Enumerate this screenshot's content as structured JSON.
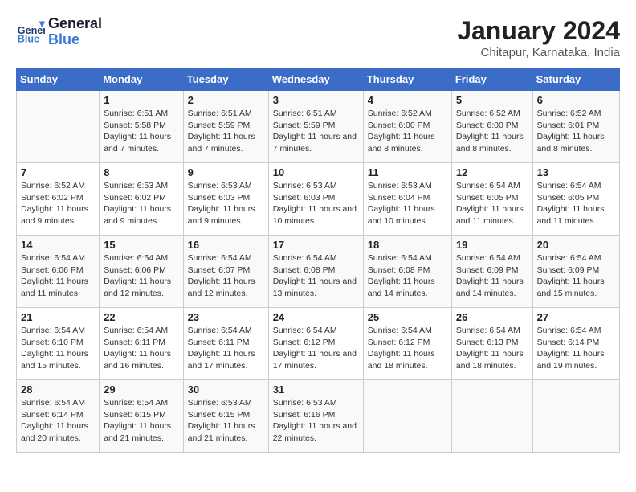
{
  "header": {
    "logo_general": "General",
    "logo_blue": "Blue",
    "title": "January 2024",
    "subtitle": "Chitapur, Karnataka, India"
  },
  "columns": [
    "Sunday",
    "Monday",
    "Tuesday",
    "Wednesday",
    "Thursday",
    "Friday",
    "Saturday"
  ],
  "weeks": [
    [
      {
        "day": "",
        "sunrise": "",
        "sunset": "",
        "daylight": ""
      },
      {
        "day": "1",
        "sunrise": "Sunrise: 6:51 AM",
        "sunset": "Sunset: 5:58 PM",
        "daylight": "Daylight: 11 hours and 7 minutes."
      },
      {
        "day": "2",
        "sunrise": "Sunrise: 6:51 AM",
        "sunset": "Sunset: 5:59 PM",
        "daylight": "Daylight: 11 hours and 7 minutes."
      },
      {
        "day": "3",
        "sunrise": "Sunrise: 6:51 AM",
        "sunset": "Sunset: 5:59 PM",
        "daylight": "Daylight: 11 hours and 7 minutes."
      },
      {
        "day": "4",
        "sunrise": "Sunrise: 6:52 AM",
        "sunset": "Sunset: 6:00 PM",
        "daylight": "Daylight: 11 hours and 8 minutes."
      },
      {
        "day": "5",
        "sunrise": "Sunrise: 6:52 AM",
        "sunset": "Sunset: 6:00 PM",
        "daylight": "Daylight: 11 hours and 8 minutes."
      },
      {
        "day": "6",
        "sunrise": "Sunrise: 6:52 AM",
        "sunset": "Sunset: 6:01 PM",
        "daylight": "Daylight: 11 hours and 8 minutes."
      }
    ],
    [
      {
        "day": "7",
        "sunrise": "Sunrise: 6:52 AM",
        "sunset": "Sunset: 6:02 PM",
        "daylight": "Daylight: 11 hours and 9 minutes."
      },
      {
        "day": "8",
        "sunrise": "Sunrise: 6:53 AM",
        "sunset": "Sunset: 6:02 PM",
        "daylight": "Daylight: 11 hours and 9 minutes."
      },
      {
        "day": "9",
        "sunrise": "Sunrise: 6:53 AM",
        "sunset": "Sunset: 6:03 PM",
        "daylight": "Daylight: 11 hours and 9 minutes."
      },
      {
        "day": "10",
        "sunrise": "Sunrise: 6:53 AM",
        "sunset": "Sunset: 6:03 PM",
        "daylight": "Daylight: 11 hours and 10 minutes."
      },
      {
        "day": "11",
        "sunrise": "Sunrise: 6:53 AM",
        "sunset": "Sunset: 6:04 PM",
        "daylight": "Daylight: 11 hours and 10 minutes."
      },
      {
        "day": "12",
        "sunrise": "Sunrise: 6:54 AM",
        "sunset": "Sunset: 6:05 PM",
        "daylight": "Daylight: 11 hours and 11 minutes."
      },
      {
        "day": "13",
        "sunrise": "Sunrise: 6:54 AM",
        "sunset": "Sunset: 6:05 PM",
        "daylight": "Daylight: 11 hours and 11 minutes."
      }
    ],
    [
      {
        "day": "14",
        "sunrise": "Sunrise: 6:54 AM",
        "sunset": "Sunset: 6:06 PM",
        "daylight": "Daylight: 11 hours and 11 minutes."
      },
      {
        "day": "15",
        "sunrise": "Sunrise: 6:54 AM",
        "sunset": "Sunset: 6:06 PM",
        "daylight": "Daylight: 11 hours and 12 minutes."
      },
      {
        "day": "16",
        "sunrise": "Sunrise: 6:54 AM",
        "sunset": "Sunset: 6:07 PM",
        "daylight": "Daylight: 11 hours and 12 minutes."
      },
      {
        "day": "17",
        "sunrise": "Sunrise: 6:54 AM",
        "sunset": "Sunset: 6:08 PM",
        "daylight": "Daylight: 11 hours and 13 minutes."
      },
      {
        "day": "18",
        "sunrise": "Sunrise: 6:54 AM",
        "sunset": "Sunset: 6:08 PM",
        "daylight": "Daylight: 11 hours and 14 minutes."
      },
      {
        "day": "19",
        "sunrise": "Sunrise: 6:54 AM",
        "sunset": "Sunset: 6:09 PM",
        "daylight": "Daylight: 11 hours and 14 minutes."
      },
      {
        "day": "20",
        "sunrise": "Sunrise: 6:54 AM",
        "sunset": "Sunset: 6:09 PM",
        "daylight": "Daylight: 11 hours and 15 minutes."
      }
    ],
    [
      {
        "day": "21",
        "sunrise": "Sunrise: 6:54 AM",
        "sunset": "Sunset: 6:10 PM",
        "daylight": "Daylight: 11 hours and 15 minutes."
      },
      {
        "day": "22",
        "sunrise": "Sunrise: 6:54 AM",
        "sunset": "Sunset: 6:11 PM",
        "daylight": "Daylight: 11 hours and 16 minutes."
      },
      {
        "day": "23",
        "sunrise": "Sunrise: 6:54 AM",
        "sunset": "Sunset: 6:11 PM",
        "daylight": "Daylight: 11 hours and 17 minutes."
      },
      {
        "day": "24",
        "sunrise": "Sunrise: 6:54 AM",
        "sunset": "Sunset: 6:12 PM",
        "daylight": "Daylight: 11 hours and 17 minutes."
      },
      {
        "day": "25",
        "sunrise": "Sunrise: 6:54 AM",
        "sunset": "Sunset: 6:12 PM",
        "daylight": "Daylight: 11 hours and 18 minutes."
      },
      {
        "day": "26",
        "sunrise": "Sunrise: 6:54 AM",
        "sunset": "Sunset: 6:13 PM",
        "daylight": "Daylight: 11 hours and 18 minutes."
      },
      {
        "day": "27",
        "sunrise": "Sunrise: 6:54 AM",
        "sunset": "Sunset: 6:14 PM",
        "daylight": "Daylight: 11 hours and 19 minutes."
      }
    ],
    [
      {
        "day": "28",
        "sunrise": "Sunrise: 6:54 AM",
        "sunset": "Sunset: 6:14 PM",
        "daylight": "Daylight: 11 hours and 20 minutes."
      },
      {
        "day": "29",
        "sunrise": "Sunrise: 6:54 AM",
        "sunset": "Sunset: 6:15 PM",
        "daylight": "Daylight: 11 hours and 21 minutes."
      },
      {
        "day": "30",
        "sunrise": "Sunrise: 6:53 AM",
        "sunset": "Sunset: 6:15 PM",
        "daylight": "Daylight: 11 hours and 21 minutes."
      },
      {
        "day": "31",
        "sunrise": "Sunrise: 6:53 AM",
        "sunset": "Sunset: 6:16 PM",
        "daylight": "Daylight: 11 hours and 22 minutes."
      },
      {
        "day": "",
        "sunrise": "",
        "sunset": "",
        "daylight": ""
      },
      {
        "day": "",
        "sunrise": "",
        "sunset": "",
        "daylight": ""
      },
      {
        "day": "",
        "sunrise": "",
        "sunset": "",
        "daylight": ""
      }
    ]
  ]
}
